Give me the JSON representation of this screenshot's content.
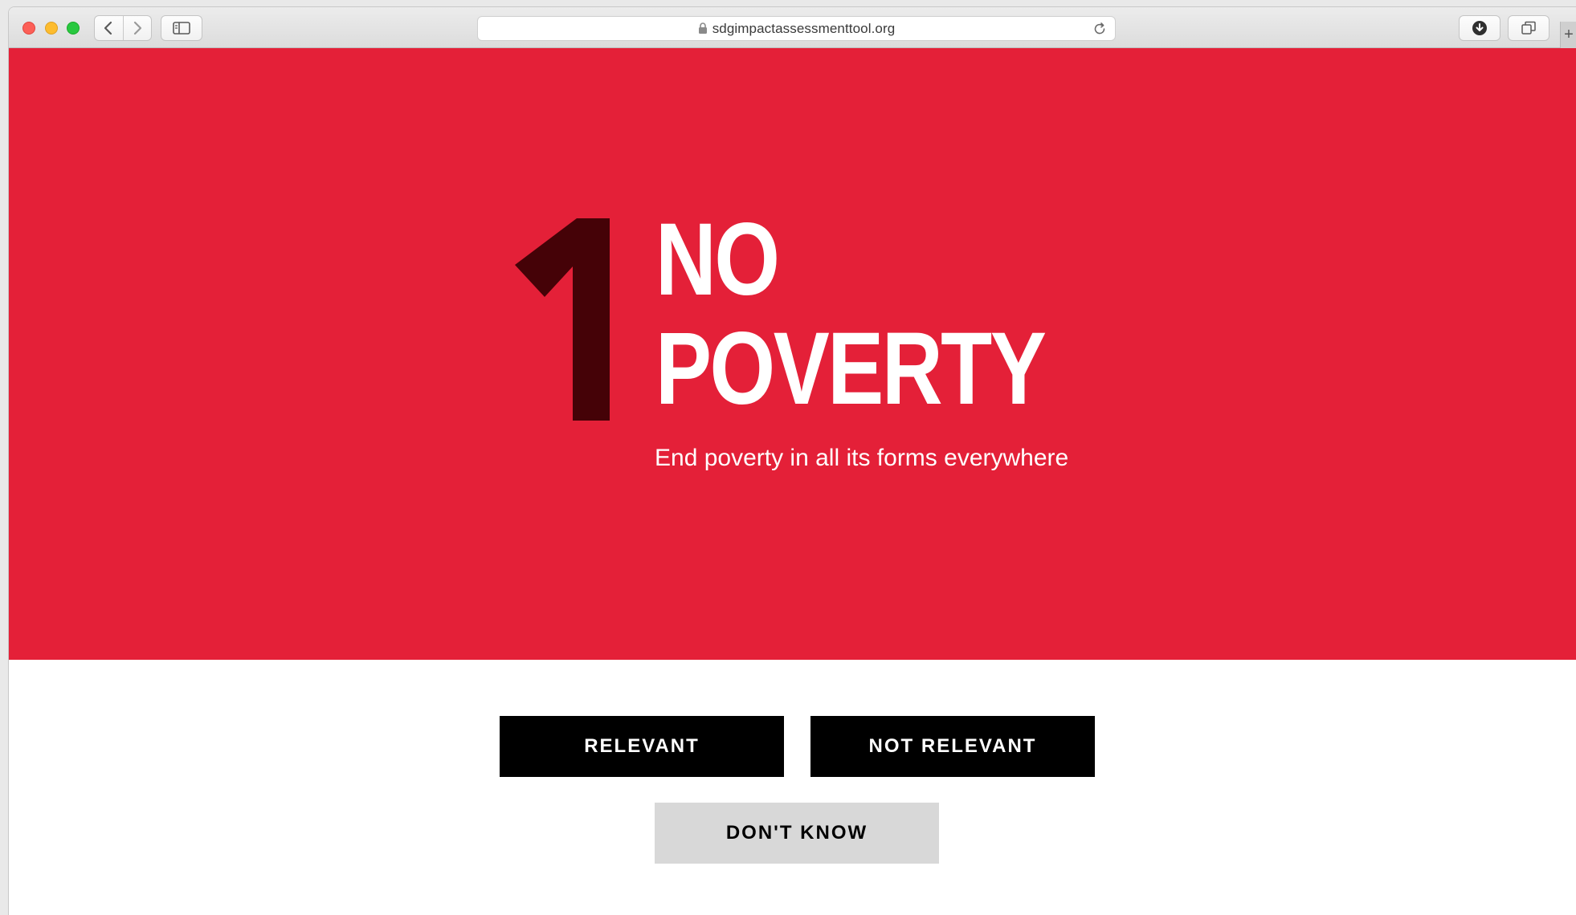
{
  "browser": {
    "url": "sdgimpactassessmenttool.org",
    "icons": {
      "back": "chevron-left-icon",
      "forward": "chevron-right-icon",
      "sidebar": "sidebar-icon",
      "lock": "lock-icon",
      "reload": "reload-icon",
      "downloads": "download-icon",
      "tabs": "tab-overview-icon",
      "new_tab": "plus-icon"
    },
    "new_tab_label": "+"
  },
  "goal": {
    "number": "1",
    "title_line1": "NO",
    "title_line2": "POVERTY",
    "subtitle": "End poverty in all its forms everywhere",
    "colors": {
      "background": "#e42038",
      "number": "#450207",
      "text": "#ffffff"
    }
  },
  "actions": {
    "relevant_label": "RELEVANT",
    "not_relevant_label": "NOT RELEVANT",
    "dont_know_label": "DON'T KNOW"
  }
}
